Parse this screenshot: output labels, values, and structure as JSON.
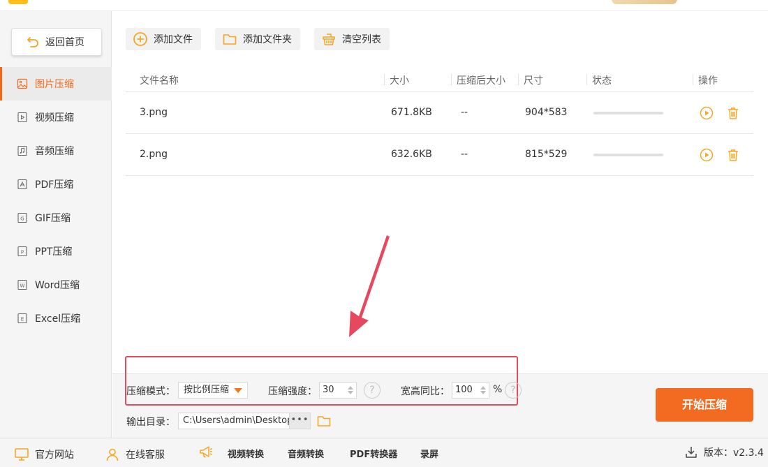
{
  "app": {
    "title": ""
  },
  "sidebar": {
    "back_label": "返回首页",
    "items": [
      {
        "label": "图片压缩",
        "icon": "image-icon",
        "active": true
      },
      {
        "label": "视频压缩",
        "icon": "video-icon"
      },
      {
        "label": "音频压缩",
        "icon": "music-icon"
      },
      {
        "label": "PDF压缩",
        "icon": "pdf-icon"
      },
      {
        "label": "GIF压缩",
        "icon": "gif-icon"
      },
      {
        "label": "PPT压缩",
        "icon": "ppt-icon"
      },
      {
        "label": "Word压缩",
        "icon": "word-icon"
      },
      {
        "label": "Excel压缩",
        "icon": "excel-icon"
      }
    ]
  },
  "toolbar": {
    "add_file": "添加文件",
    "add_folder": "添加文件夹",
    "clear_list": "清空列表"
  },
  "table": {
    "columns": [
      "文件名称",
      "大小",
      "压缩后大小",
      "尺寸",
      "状态",
      "操作"
    ],
    "rows": [
      {
        "name": "3.png",
        "size": "671.8KB",
        "compressed": "--",
        "dims": "904*583"
      },
      {
        "name": "2.png",
        "size": "632.6KB",
        "compressed": "--",
        "dims": "815*529"
      }
    ]
  },
  "settings": {
    "mode_label": "压缩模式：",
    "mode_value": "按比例压缩",
    "strength_label": "压缩强度：",
    "strength_value": "30",
    "ratio_label": "宽高同比：",
    "ratio_value": "100",
    "ratio_unit": "%",
    "help_glyph": "?",
    "output_label": "输出目录：",
    "output_path": "C:\\Users\\admin\\Desktop\\",
    "dots": "•••",
    "start_label": "开始压缩"
  },
  "footer": {
    "website": "官方网站",
    "service": "在线客服",
    "video_convert": "视频转换",
    "audio_convert": "音频转换",
    "pdf_convert": "PDF转换器",
    "record": "录屏",
    "version_label": "版本：",
    "version_value": "v2.3.4"
  },
  "colors": {
    "accent": "#f36a21",
    "highlight": "#e5485f",
    "icon_orange": "#f5a623"
  }
}
